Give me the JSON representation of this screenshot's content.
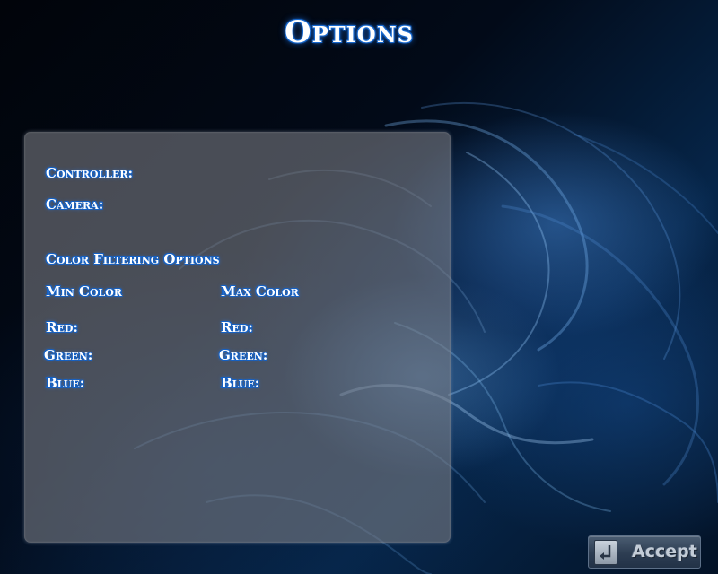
{
  "screen": {
    "title": "Options"
  },
  "panel": {
    "controller_label": "Controller:",
    "camera_label": "Camera:",
    "section_title": "Color Filtering Options",
    "min_color": {
      "heading": "Min Color",
      "red_label": "Red:",
      "green_label": "Green:",
      "blue_label": "Blue:"
    },
    "max_color": {
      "heading": "Max Color",
      "red_label": "Red:",
      "green_label": "Green:",
      "blue_label": "Blue:"
    }
  },
  "accept_button": {
    "label": "Accept",
    "icon": "enter-return-icon"
  },
  "colors": {
    "text_fill": "#ffffff",
    "text_glow": "#1561c4",
    "panel_fill": "#7d8086",
    "background_accent": "#2a6db5"
  }
}
